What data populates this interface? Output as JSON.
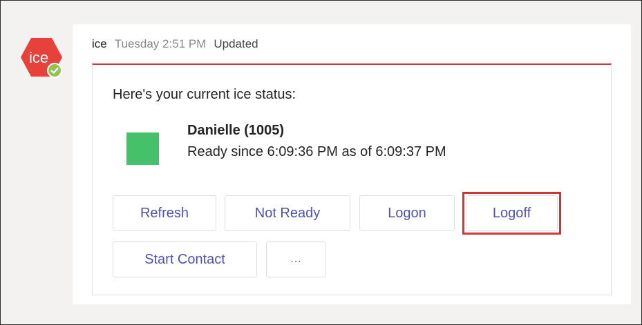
{
  "bot": {
    "avatar_text": "ice",
    "brand_color": "#e8413b",
    "presence_color": "#92c353",
    "presence_icon": "checkmark-icon"
  },
  "message": {
    "sender": "ice",
    "timestamp": "Tuesday 2:51 PM",
    "edited_label": "Updated"
  },
  "card": {
    "accent_color": "#d13438",
    "heading": "Here's your current ice status:",
    "agent": {
      "name": "Danielle (1005)",
      "status_text": "Ready since 6:09:36 PM as of 6:09:37 PM",
      "status_color": "#45c16a"
    },
    "actions": [
      {
        "label": "Refresh"
      },
      {
        "label": "Not Ready"
      },
      {
        "label": "Logon"
      },
      {
        "label": "Logoff"
      },
      {
        "label": "Start Contact"
      },
      {
        "label": "..."
      }
    ]
  }
}
